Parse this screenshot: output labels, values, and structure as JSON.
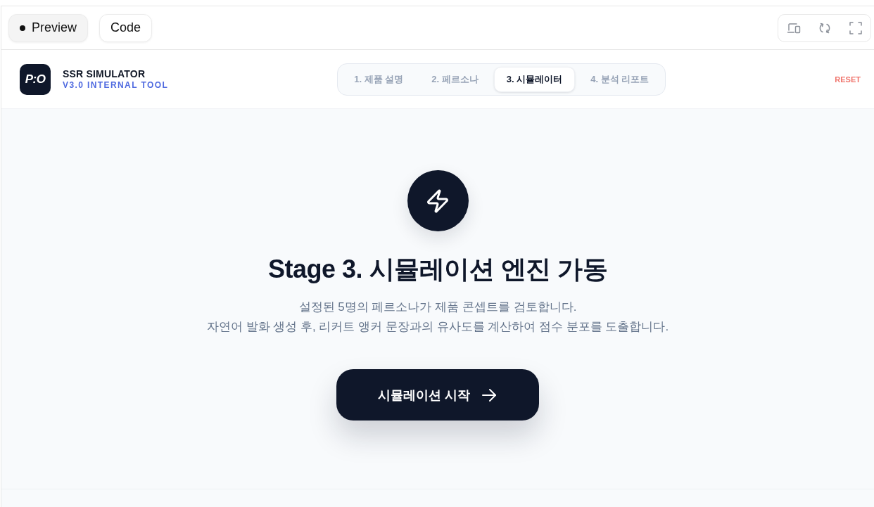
{
  "toolbar": {
    "view_tabs": [
      {
        "label": "Preview",
        "selected": true
      },
      {
        "label": "Code",
        "selected": false
      }
    ]
  },
  "app_header": {
    "logo": "P:O",
    "title": "SSR SIMULATOR",
    "subtitle": "V3.0 INTERNAL TOOL",
    "steps": [
      {
        "label": "1. 제품 설명",
        "selected": false
      },
      {
        "label": "2. 페르소나",
        "selected": false
      },
      {
        "label": "3. 시뮬레이터",
        "selected": true
      },
      {
        "label": "4. 분석 리포트",
        "selected": false
      }
    ],
    "reset": "RESET"
  },
  "stage": {
    "heading": "Stage 3. 시뮬레이션 엔진 가동",
    "description": [
      "설정된 5명의 페르소나가 제품 콘셉트를 검토합니다.",
      "자연어 발화 생성 후, 리커트 앵커 문장과의 유사도를 계산하여 점수 분포를 도출합니다."
    ],
    "start_button": "시뮬레이션 시작"
  }
}
